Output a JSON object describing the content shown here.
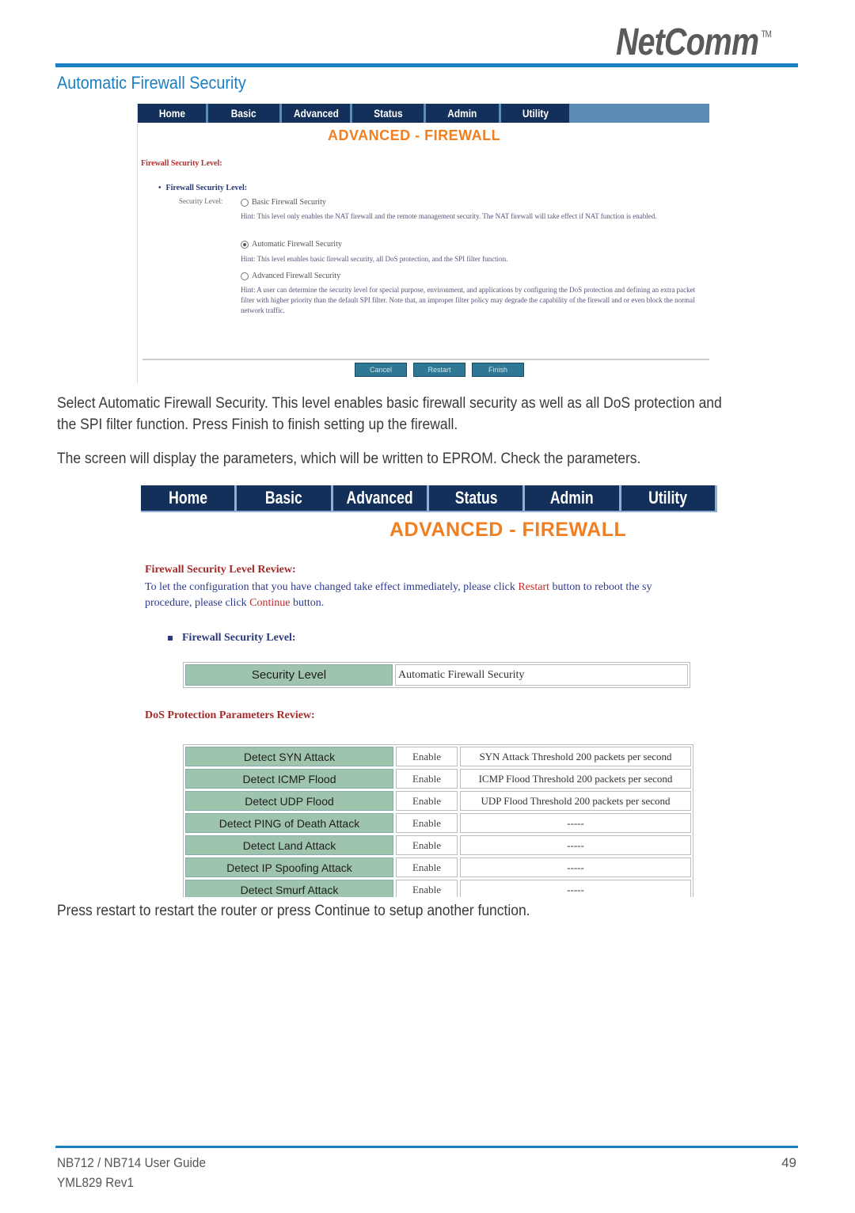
{
  "header": {
    "logo_text": "NetComm",
    "logo_tm": "TM",
    "section_title": "Automatic Firewall Security",
    "accent_color": "#1b7fc4"
  },
  "screenshot1": {
    "nav_tabs": [
      "Home",
      "Basic",
      "Advanced",
      "Status",
      "Admin",
      "Utility"
    ],
    "page_title": "ADVANCED - FIREWALL",
    "heading": "Firewall Security Level:",
    "bullet": "Firewall Security Level:",
    "field_label": "Security Level:",
    "options": [
      {
        "label": "Basic Firewall Security",
        "selected": false,
        "hint": "Hint: This level only enables the NAT firewall and the remote management security. The NAT firewall will take effect if NAT function is enabled."
      },
      {
        "label": "Automatic Firewall Security",
        "selected": true,
        "hint": "Hint: This level enables basic firewall security, all DoS protection, and the SPI filter function."
      },
      {
        "label": "Advanced Firewall Security",
        "selected": false,
        "hint": "Hint: A user can determine the security level for special purpose, environment, and applications by configuring the DoS protection and defining an extra packet filter with higher priority than the default SPI filter. Note that, an improper filter policy may degrade the capability of the firewall and or even block the normal network traffic."
      }
    ],
    "buttons": {
      "cancel": "Cancel",
      "restart": "Restart",
      "finish": "Finish"
    }
  },
  "body": {
    "para1": "Select Automatic Firewall Security.  This level enables basic firewall security as well as all DoS protection and the SPI filter function.  Press Finish to finish setting up the firewall.",
    "para2": "The screen will display the parameters, which will be written to EPROM. Check the parameters.",
    "para3": "Press restart to restart the router or press Continue to setup another function."
  },
  "screenshot2": {
    "nav_tabs": [
      "Home",
      "Basic",
      "Advanced",
      "Status",
      "Admin",
      "Utility"
    ],
    "page_title": "ADVANCED - FIREWALL",
    "review_heading": "Firewall Security Level Review:",
    "review_text_1": "To let the configuration that you have changed take effect immediately,  please click ",
    "review_restart": "Restart",
    "review_text_2": " button to reboot the sy",
    "review_text_3": "procedure, please click ",
    "review_continue": "Continue",
    "review_text_4": " button.",
    "fsl_bullet": "Firewall Security Level:",
    "security_level_label": "Security Level",
    "security_level_value": "Automatic Firewall Security",
    "dos_heading": "DoS Protection Parameters Review:",
    "dos_rows": [
      {
        "name": "Detect SYN Attack",
        "status": "Enable",
        "threshold": "SYN Attack Threshold 200 packets per second"
      },
      {
        "name": "Detect ICMP Flood",
        "status": "Enable",
        "threshold": "ICMP Flood Threshold 200 packets per second"
      },
      {
        "name": "Detect UDP Flood",
        "status": "Enable",
        "threshold": "UDP Flood Threshold 200 packets per second"
      },
      {
        "name": "Detect PING of Death Attack",
        "status": "Enable",
        "threshold": "-----"
      },
      {
        "name": "Detect Land Attack",
        "status": "Enable",
        "threshold": "-----"
      },
      {
        "name": "Detect IP Spoofing Attack",
        "status": "Enable",
        "threshold": "-----"
      },
      {
        "name": "Detect Smurf Attack",
        "status": "Enable",
        "threshold": "-----"
      }
    ]
  },
  "footer": {
    "guide": "NB712 / NB714 User Guide",
    "rev": "YML829 Rev1",
    "page": "49"
  }
}
